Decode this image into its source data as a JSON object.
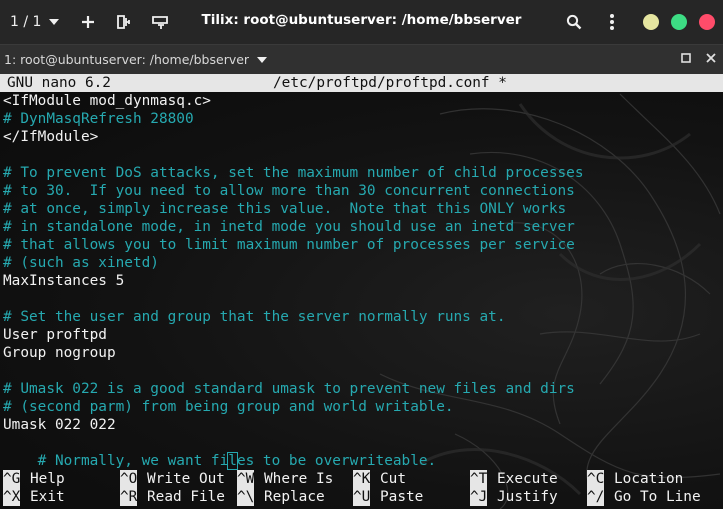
{
  "window": {
    "app_title": "Tilix: root@ubuntuserver: /home/bbserver",
    "session_counter": "1 / 1",
    "controls": {
      "minimize_color": "#e5e5a0",
      "maximize_color": "#3ddc84",
      "close_color": "#ff4c6a"
    },
    "toolbar_icons": [
      "chevron-down-icon",
      "plus-icon",
      "split-right-icon",
      "split-down-icon",
      "search-icon",
      "kebab-menu-icon"
    ]
  },
  "terminal_tab": {
    "title": "1: root@ubuntuserver: /home/bbserver"
  },
  "nano": {
    "version": "GNU nano 6.2",
    "filename": "/etc/proftpd/proftpd.conf *",
    "lines": [
      {
        "kind": "plain",
        "text": "<IfModule mod_dynmasq.c>"
      },
      {
        "kind": "comment",
        "text": "# DynMasqRefresh 28800"
      },
      {
        "kind": "plain",
        "text": "</IfModule>"
      },
      {
        "kind": "plain",
        "text": ""
      },
      {
        "kind": "comment",
        "text": "# To prevent DoS attacks, set the maximum number of child processes"
      },
      {
        "kind": "comment",
        "text": "# to 30.  If you need to allow more than 30 concurrent connections"
      },
      {
        "kind": "comment",
        "text": "# at once, simply increase this value.  Note that this ONLY works"
      },
      {
        "kind": "comment",
        "text": "# in standalone mode, in inetd mode you should use an inetd server"
      },
      {
        "kind": "comment",
        "text": "# that allows you to limit maximum number of processes per service"
      },
      {
        "kind": "comment",
        "text": "# (such as xinetd)"
      },
      {
        "kind": "plain",
        "text": "MaxInstances 5"
      },
      {
        "kind": "plain",
        "text": ""
      },
      {
        "kind": "comment",
        "text": "# Set the user and group that the server normally runs at."
      },
      {
        "kind": "plain",
        "text": "User proftpd"
      },
      {
        "kind": "plain",
        "text": "Group nogroup"
      },
      {
        "kind": "plain",
        "text": ""
      },
      {
        "kind": "comment",
        "text": "# Umask 022 is a good standard umask to prevent new files and dirs"
      },
      {
        "kind": "comment",
        "text": "# (second parm) from being group and world writable."
      },
      {
        "kind": "plain",
        "text": "Umask 022 022"
      }
    ],
    "cursor_line": {
      "before": "# Normally, we want fi",
      "cursor_char": "l",
      "after": "es to be overwriteable."
    },
    "shortcuts_row1": [
      {
        "key": "^G",
        "label": "Help"
      },
      {
        "key": "^O",
        "label": "Write Out"
      },
      {
        "key": "^W",
        "label": "Where Is"
      },
      {
        "key": "^K",
        "label": "Cut"
      },
      {
        "key": "^T",
        "label": "Execute"
      },
      {
        "key": "^C",
        "label": "Location"
      }
    ],
    "shortcuts_row2": [
      {
        "key": "^X",
        "label": "Exit"
      },
      {
        "key": "^R",
        "label": "Read File"
      },
      {
        "key": "^\\",
        "label": "Replace"
      },
      {
        "key": "^U",
        "label": "Paste"
      },
      {
        "key": "^J",
        "label": "Justify"
      },
      {
        "key": "^/",
        "label": "Go To Line"
      }
    ]
  }
}
